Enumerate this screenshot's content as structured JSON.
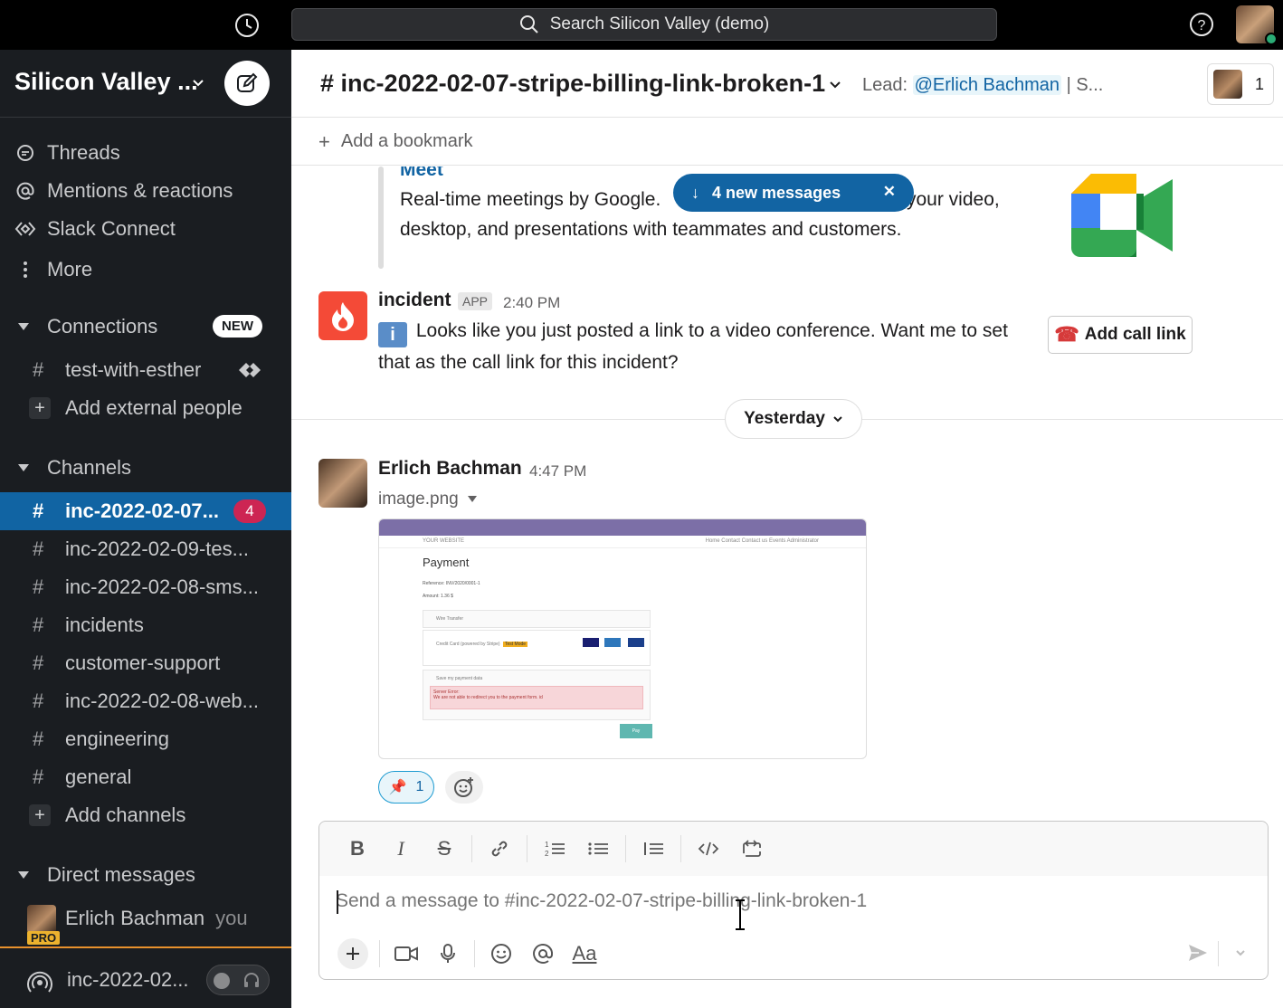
{
  "search": {
    "placeholder": "Search Silicon Valley (demo)"
  },
  "workspace": {
    "name": "Silicon Valley ..."
  },
  "nav": {
    "threads": "Threads",
    "mentions": "Mentions & reactions",
    "slack_connect": "Slack Connect",
    "more": "More"
  },
  "connections": {
    "title": "Connections",
    "badge": "NEW",
    "items": [
      {
        "name": "test-with-esther"
      }
    ],
    "add": "Add external people"
  },
  "channels": {
    "title": "Channels",
    "items": [
      {
        "name": "inc-2022-02-07...",
        "badge": "4",
        "active": true
      },
      {
        "name": "inc-2022-02-09-tes..."
      },
      {
        "name": "inc-2022-02-08-sms..."
      },
      {
        "name": "incidents"
      },
      {
        "name": "customer-support"
      },
      {
        "name": "inc-2022-02-08-web..."
      },
      {
        "name": "engineering"
      },
      {
        "name": "general"
      }
    ],
    "add": "Add channels"
  },
  "dms": {
    "title": "Direct messages",
    "items": [
      {
        "name": "Erlich Bachman",
        "suffix": "you",
        "tag": "PRO"
      }
    ]
  },
  "huddle": {
    "channel": "inc-2022-02..."
  },
  "channel": {
    "hash": "#",
    "name": "inc-2022-02-07-stripe-billing-link-broken-1",
    "lead_label": "Lead:",
    "lead_mention": "@Erlich Bachman",
    "lead_rest": "| S...",
    "member_count": "1",
    "bookmark_label": "Add a bookmark"
  },
  "attachment": {
    "title": "Meet",
    "desc_part1": "Real-time meetings by Google.",
    "desc_part2": "your video,",
    "desc_line2": "desktop, and presentations with teammates and customers."
  },
  "new_messages": {
    "label": "4 new messages"
  },
  "messages": [
    {
      "author": "incident",
      "tag": "APP",
      "time": "2:40 PM",
      "text": "Looks like you just posted a link to a video conference. Want me to set that as the call link for this incident?",
      "info_icon": "i",
      "action": "Add call link",
      "action_icon": "☎"
    },
    {
      "author": "Erlich Bachman",
      "time": "4:47 PM",
      "file": "image.png",
      "reaction": {
        "emoji": "📌",
        "count": "1"
      }
    }
  ],
  "day_divider": "Yesterday",
  "image_preview": {
    "title": "Payment",
    "ref": "Reference: INV/2020/0001-1",
    "amount": "Amount: 1.36 $",
    "opt1": "Wire Transfer",
    "opt2": "Credit Card (powered by Stripe)",
    "tag": "Test Mode",
    "save": "Save my payment data",
    "err1": "Server Error:",
    "err2": "We are not able to redirect you to the payment form. id",
    "pay": "Pay",
    "website": "YOUR WEBSITE",
    "topnav": "Home   Contact   Contact us   Events   Administrator"
  },
  "composer": {
    "placeholder": "Send a message to #inc-2022-02-07-stripe-billing-link-broken-1",
    "format_label": "Aa"
  },
  "colors": {
    "sidebar_bg": "#1a1d21",
    "active_channel": "#1164a3",
    "badge_red": "#cd2553",
    "link_blue": "#1264a3",
    "presence_green": "#2bac76"
  }
}
